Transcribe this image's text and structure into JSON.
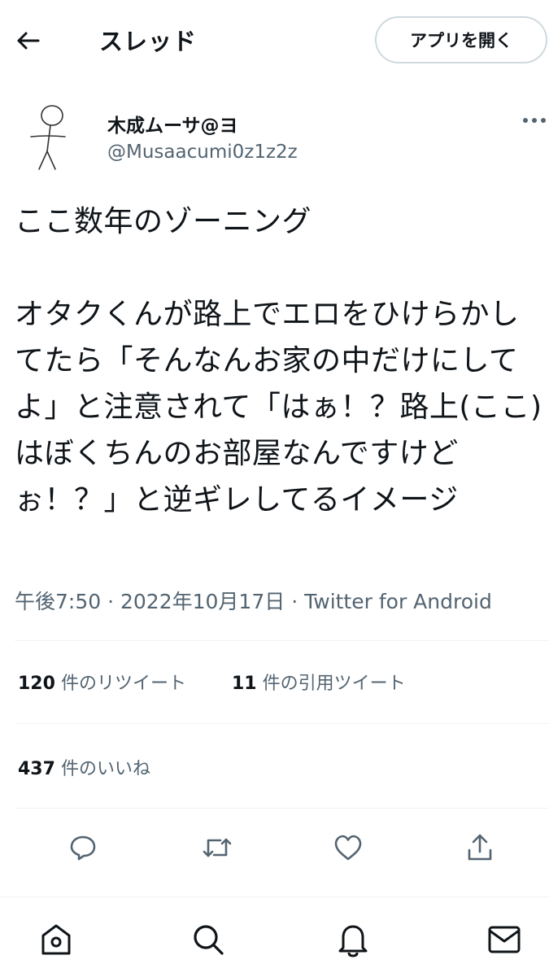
{
  "header": {
    "title": "スレッド",
    "open_app_label": "アプリを開く"
  },
  "author": {
    "display_name": "木成ムーサ@ヨ",
    "handle": "@Musaacumi0z1z2z"
  },
  "tweet": {
    "text": "ここ数年のゾーニング\n\nオタクくんが路上でエロをひけらかしてたら「そんなんお家の中だけにしてよ」と注意されて「はぁ！？路上(ここ)はぼくちんのお部屋なんですけどぉ！？」と逆ギレしてるイメージ",
    "time": "午後7:50",
    "date": "2022年10月17日",
    "source": "Twitter for Android",
    "separator": "·"
  },
  "stats": {
    "retweets_count": "120",
    "retweets_label": "件のリツイート",
    "quotes_count": "11",
    "quotes_label": "件の引用ツイート",
    "likes_count": "437",
    "likes_label": "件のいいね"
  },
  "icons": {
    "back": "back-arrow-icon",
    "more": "more-icon",
    "reply": "reply-icon",
    "retweet": "retweet-icon",
    "like": "heart-icon",
    "share": "share-icon",
    "home": "home-icon",
    "explore": "search-icon",
    "notifications": "bell-icon",
    "messages": "mail-icon"
  },
  "colors": {
    "text": "#0f1419",
    "secondary": "#536471",
    "border": "#cfd9de",
    "divider": "#eff3f4"
  }
}
